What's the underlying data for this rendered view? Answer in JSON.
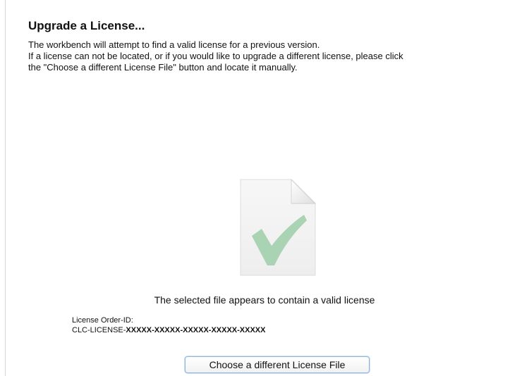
{
  "header": {
    "title": "Upgrade a License..."
  },
  "description": {
    "line1": "The workbench will attempt to find a valid license for a previous version.",
    "line2": "If a license can not be located, or if you would like to upgrade a different license, please click",
    "line3": "the \"Choose a different License File\" button and locate it manually."
  },
  "file": {
    "icon": "document-checkmark-icon",
    "status": "The selected file appears to contain a valid license",
    "check_color": "#a9d3b3"
  },
  "license": {
    "label": "License Order-ID:",
    "prefix": "CLC-LICENSE-",
    "masked_id": "XXXXX-XXXXX-XXXXX-XXXXX-XXXXX"
  },
  "actions": {
    "choose_label": "Choose a different License File"
  }
}
